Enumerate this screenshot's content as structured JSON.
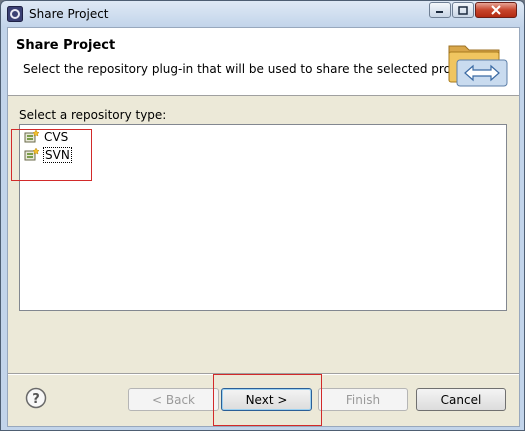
{
  "window": {
    "title": "Share Project"
  },
  "header": {
    "title": "Share Project",
    "description": "Select the repository plug-in that will be used to share the selected project."
  },
  "repository_section": {
    "label": "Select a repository type:",
    "items": [
      {
        "label": "CVS",
        "icon": "repository-icon",
        "selected": false
      },
      {
        "label": "SVN",
        "icon": "repository-icon",
        "selected": true
      }
    ]
  },
  "buttons": {
    "back": "< Back",
    "next": "Next >",
    "finish": "Finish",
    "cancel": "Cancel"
  },
  "colors": {
    "highlight": "#d22a2a"
  }
}
